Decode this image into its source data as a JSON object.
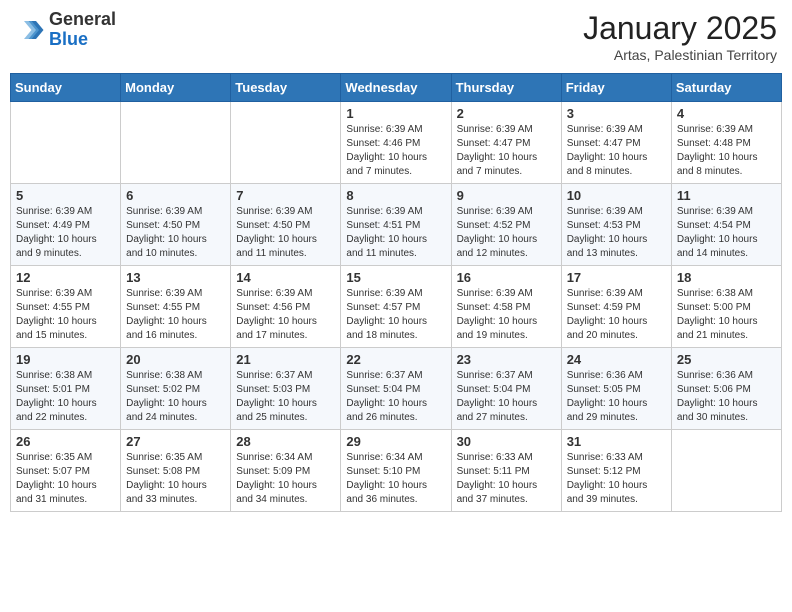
{
  "header": {
    "logo_general": "General",
    "logo_blue": "Blue",
    "cal_title": "January 2025",
    "cal_subtitle": "Artas, Palestinian Territory"
  },
  "days_of_week": [
    "Sunday",
    "Monday",
    "Tuesday",
    "Wednesday",
    "Thursday",
    "Friday",
    "Saturday"
  ],
  "weeks": [
    [
      {
        "day": "",
        "info": ""
      },
      {
        "day": "",
        "info": ""
      },
      {
        "day": "",
        "info": ""
      },
      {
        "day": "1",
        "info": "Sunrise: 6:39 AM\nSunset: 4:46 PM\nDaylight: 10 hours\nand 7 minutes."
      },
      {
        "day": "2",
        "info": "Sunrise: 6:39 AM\nSunset: 4:47 PM\nDaylight: 10 hours\nand 7 minutes."
      },
      {
        "day": "3",
        "info": "Sunrise: 6:39 AM\nSunset: 4:47 PM\nDaylight: 10 hours\nand 8 minutes."
      },
      {
        "day": "4",
        "info": "Sunrise: 6:39 AM\nSunset: 4:48 PM\nDaylight: 10 hours\nand 8 minutes."
      }
    ],
    [
      {
        "day": "5",
        "info": "Sunrise: 6:39 AM\nSunset: 4:49 PM\nDaylight: 10 hours\nand 9 minutes."
      },
      {
        "day": "6",
        "info": "Sunrise: 6:39 AM\nSunset: 4:50 PM\nDaylight: 10 hours\nand 10 minutes."
      },
      {
        "day": "7",
        "info": "Sunrise: 6:39 AM\nSunset: 4:50 PM\nDaylight: 10 hours\nand 11 minutes."
      },
      {
        "day": "8",
        "info": "Sunrise: 6:39 AM\nSunset: 4:51 PM\nDaylight: 10 hours\nand 11 minutes."
      },
      {
        "day": "9",
        "info": "Sunrise: 6:39 AM\nSunset: 4:52 PM\nDaylight: 10 hours\nand 12 minutes."
      },
      {
        "day": "10",
        "info": "Sunrise: 6:39 AM\nSunset: 4:53 PM\nDaylight: 10 hours\nand 13 minutes."
      },
      {
        "day": "11",
        "info": "Sunrise: 6:39 AM\nSunset: 4:54 PM\nDaylight: 10 hours\nand 14 minutes."
      }
    ],
    [
      {
        "day": "12",
        "info": "Sunrise: 6:39 AM\nSunset: 4:55 PM\nDaylight: 10 hours\nand 15 minutes."
      },
      {
        "day": "13",
        "info": "Sunrise: 6:39 AM\nSunset: 4:55 PM\nDaylight: 10 hours\nand 16 minutes."
      },
      {
        "day": "14",
        "info": "Sunrise: 6:39 AM\nSunset: 4:56 PM\nDaylight: 10 hours\nand 17 minutes."
      },
      {
        "day": "15",
        "info": "Sunrise: 6:39 AM\nSunset: 4:57 PM\nDaylight: 10 hours\nand 18 minutes."
      },
      {
        "day": "16",
        "info": "Sunrise: 6:39 AM\nSunset: 4:58 PM\nDaylight: 10 hours\nand 19 minutes."
      },
      {
        "day": "17",
        "info": "Sunrise: 6:39 AM\nSunset: 4:59 PM\nDaylight: 10 hours\nand 20 minutes."
      },
      {
        "day": "18",
        "info": "Sunrise: 6:38 AM\nSunset: 5:00 PM\nDaylight: 10 hours\nand 21 minutes."
      }
    ],
    [
      {
        "day": "19",
        "info": "Sunrise: 6:38 AM\nSunset: 5:01 PM\nDaylight: 10 hours\nand 22 minutes."
      },
      {
        "day": "20",
        "info": "Sunrise: 6:38 AM\nSunset: 5:02 PM\nDaylight: 10 hours\nand 24 minutes."
      },
      {
        "day": "21",
        "info": "Sunrise: 6:37 AM\nSunset: 5:03 PM\nDaylight: 10 hours\nand 25 minutes."
      },
      {
        "day": "22",
        "info": "Sunrise: 6:37 AM\nSunset: 5:04 PM\nDaylight: 10 hours\nand 26 minutes."
      },
      {
        "day": "23",
        "info": "Sunrise: 6:37 AM\nSunset: 5:04 PM\nDaylight: 10 hours\nand 27 minutes."
      },
      {
        "day": "24",
        "info": "Sunrise: 6:36 AM\nSunset: 5:05 PM\nDaylight: 10 hours\nand 29 minutes."
      },
      {
        "day": "25",
        "info": "Sunrise: 6:36 AM\nSunset: 5:06 PM\nDaylight: 10 hours\nand 30 minutes."
      }
    ],
    [
      {
        "day": "26",
        "info": "Sunrise: 6:35 AM\nSunset: 5:07 PM\nDaylight: 10 hours\nand 31 minutes."
      },
      {
        "day": "27",
        "info": "Sunrise: 6:35 AM\nSunset: 5:08 PM\nDaylight: 10 hours\nand 33 minutes."
      },
      {
        "day": "28",
        "info": "Sunrise: 6:34 AM\nSunset: 5:09 PM\nDaylight: 10 hours\nand 34 minutes."
      },
      {
        "day": "29",
        "info": "Sunrise: 6:34 AM\nSunset: 5:10 PM\nDaylight: 10 hours\nand 36 minutes."
      },
      {
        "day": "30",
        "info": "Sunrise: 6:33 AM\nSunset: 5:11 PM\nDaylight: 10 hours\nand 37 minutes."
      },
      {
        "day": "31",
        "info": "Sunrise: 6:33 AM\nSunset: 5:12 PM\nDaylight: 10 hours\nand 39 minutes."
      },
      {
        "day": "",
        "info": ""
      }
    ]
  ]
}
